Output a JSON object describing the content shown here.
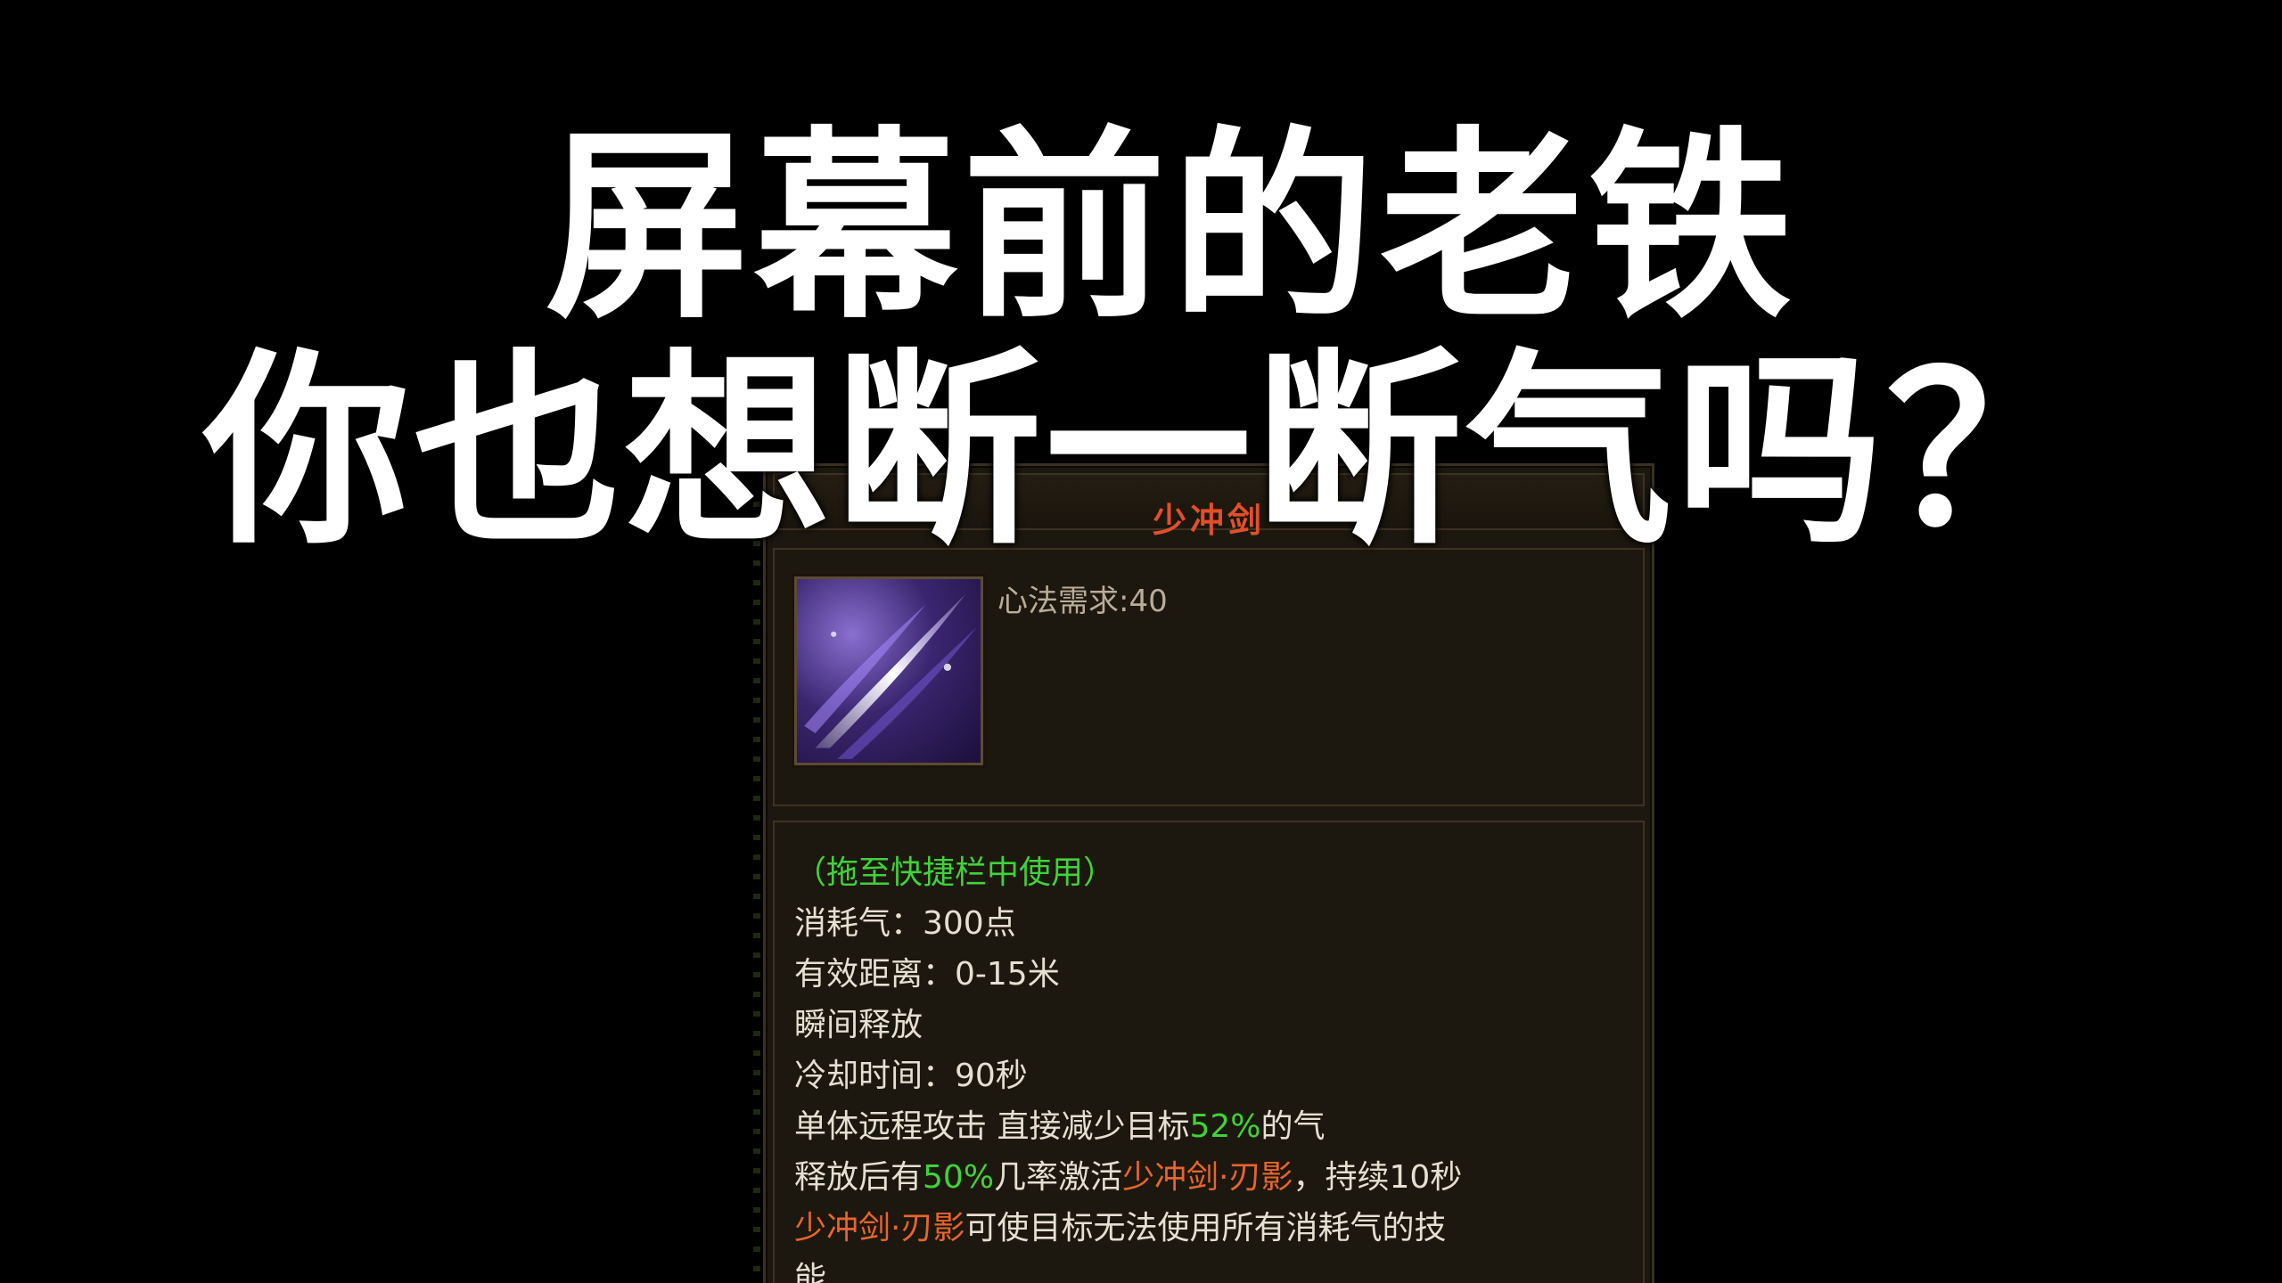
{
  "caption": {
    "line1": "屏幕前的老铁",
    "line2": "你也想断一断气吗？"
  },
  "tooltip": {
    "title": "少冲剑",
    "requirement": "心法需求:40",
    "icon": "sword-slash-icon",
    "lines": {
      "usage": "（拖至快捷栏中使用）",
      "cost": "消耗气：300点",
      "range": "有效距离：0-15米",
      "cast": "瞬间释放",
      "cooldown": "冷却时间：90秒",
      "effect_a": "单体远程攻击 直接减少目标",
      "effect_a_pct": "52%",
      "effect_a_end": "的气",
      "effect_b": "释放后有",
      "effect_b_pct": "50%",
      "effect_b_mid": "几率激活",
      "effect_b_skill": "少冲剑·刃影",
      "effect_b_end": "，持续10秒",
      "effect_c_skill": "少冲剑·刃影",
      "effect_c_end": "可使目标无法使用所有消耗气的技",
      "effect_c_wrap": "能"
    },
    "colors": {
      "title": "#e0502a",
      "highlight_green": "#3fd23a",
      "highlight_orange": "#e8642e",
      "text": "#e6dfd2"
    }
  }
}
